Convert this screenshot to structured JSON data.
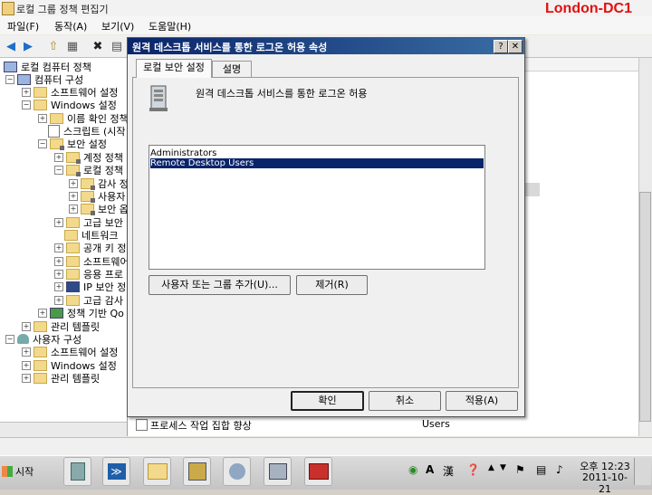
{
  "window": {
    "title": "로컬 그룹 정책 편집기",
    "host_label": "London-DC1"
  },
  "menu": [
    "파일(F)",
    "동작(A)",
    "보기(V)",
    "도움말(H)"
  ],
  "tree": [
    {
      "label": "로컬 컴퓨터 정책",
      "icon": "computer-icon"
    },
    {
      "label": "컴퓨터 구성",
      "icon": "computer-icon"
    },
    {
      "label": "소프트웨어 설정",
      "icon": "folder-icon"
    },
    {
      "label": "Windows 설정",
      "icon": "folder-icon"
    },
    {
      "label": "이름 확인 정책",
      "icon": "folder-icon"
    },
    {
      "label": "스크립트 (시작",
      "icon": "script-icon"
    },
    {
      "label": "보안 설정",
      "icon": "folder-lock-icon"
    },
    {
      "label": "계정 정책",
      "icon": "folder-lock-icon"
    },
    {
      "label": "로컬 정책",
      "icon": "folder-lock-icon"
    },
    {
      "label": "감사 정",
      "icon": "folder-lock-icon"
    },
    {
      "label": "사용자",
      "icon": "folder-lock-icon"
    },
    {
      "label": "보안 옵",
      "icon": "folder-lock-icon"
    },
    {
      "label": "고급 보안",
      "icon": "folder-icon"
    },
    {
      "label": "네트워크",
      "icon": "folder-icon"
    },
    {
      "label": "공개 키 정",
      "icon": "folder-icon"
    },
    {
      "label": "소프트웨어",
      "icon": "folder-icon"
    },
    {
      "label": "응용 프로",
      "icon": "folder-icon"
    },
    {
      "label": "IP 보안 정",
      "icon": "shield-icon"
    },
    {
      "label": "고급 감사",
      "icon": "folder-icon"
    },
    {
      "label": "정책 기반 Qo",
      "icon": "chart-icon"
    },
    {
      "label": "관리 템플릿",
      "icon": "folder-icon"
    },
    {
      "label": "사용자 구성",
      "icon": "user-icon"
    },
    {
      "label": "소프트웨어 설정",
      "icon": "folder-icon"
    },
    {
      "label": "Windows 설정",
      "icon": "folder-icon"
    },
    {
      "label": "관리 템플릿",
      "icon": "folder-icon"
    }
  ],
  "right_pane": {
    "visible_row_policy": "프로세스 작업 집합 향상",
    "visible_row_value": "Users"
  },
  "dialog": {
    "title": "원격 데스크톱 서비스를 통한 로그온 허용 속성",
    "help_label": "?",
    "close_label": "✕",
    "tabs": [
      "로컬 보안 설정",
      "설명"
    ],
    "policy_name": "원격 데스크톱 서비스를 통한 로그온 허용",
    "members": [
      "Administrators",
      "Remote Desktop Users"
    ],
    "selected_index": 1,
    "add_button": "사용자 또는 그룹 추가(U)...",
    "remove_button": "제거(R)",
    "ok_button": "확인",
    "cancel_button": "취소",
    "apply_button": "적용(A)"
  },
  "taskbar": {
    "start_label": "시작",
    "ime_label": "A",
    "hanja_label": "漢",
    "time": "오후 12:23",
    "date": "2011-10-21"
  }
}
